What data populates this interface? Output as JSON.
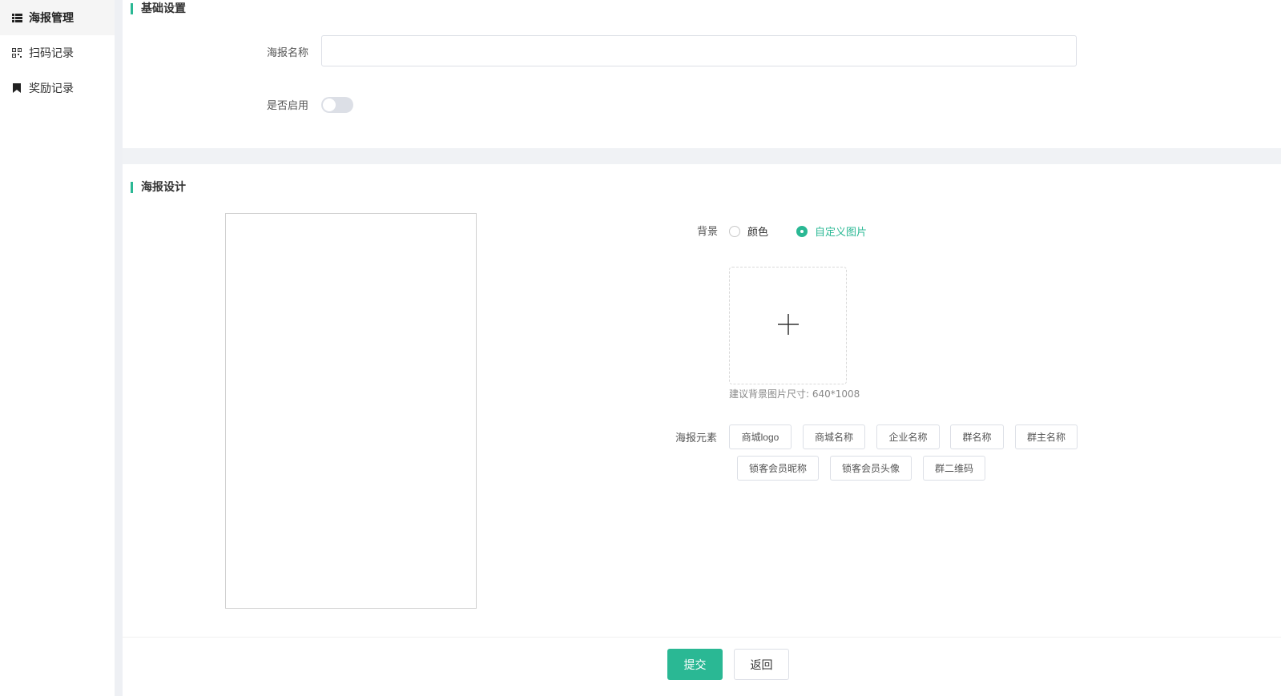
{
  "sidebar": {
    "items": [
      {
        "label": "海报管理",
        "icon": "list-icon",
        "active": true
      },
      {
        "label": "扫码记录",
        "icon": "qrcode-icon",
        "active": false
      },
      {
        "label": "奖励记录",
        "icon": "bookmark-icon",
        "active": false
      }
    ]
  },
  "basic": {
    "title": "基础设置",
    "name_label": "海报名称",
    "name_value": "",
    "name_placeholder": "",
    "enable_label": "是否启用",
    "enabled": false
  },
  "design": {
    "title": "海报设计",
    "background_label": "背景",
    "background_options": [
      {
        "label": "颜色",
        "checked": false
      },
      {
        "label": "自定义图片",
        "checked": true
      }
    ],
    "upload_hint": "建议背景图片尺寸: 640*1008",
    "elements_label": "海报元素",
    "elements": [
      "商城logo",
      "商城名称",
      "企业名称",
      "群名称",
      "群主名称",
      "锁客会员昵称",
      "锁客会员头像",
      "群二维码"
    ]
  },
  "footer": {
    "submit_label": "提交",
    "back_label": "返回"
  },
  "colors": {
    "accent": "#2ab894"
  }
}
